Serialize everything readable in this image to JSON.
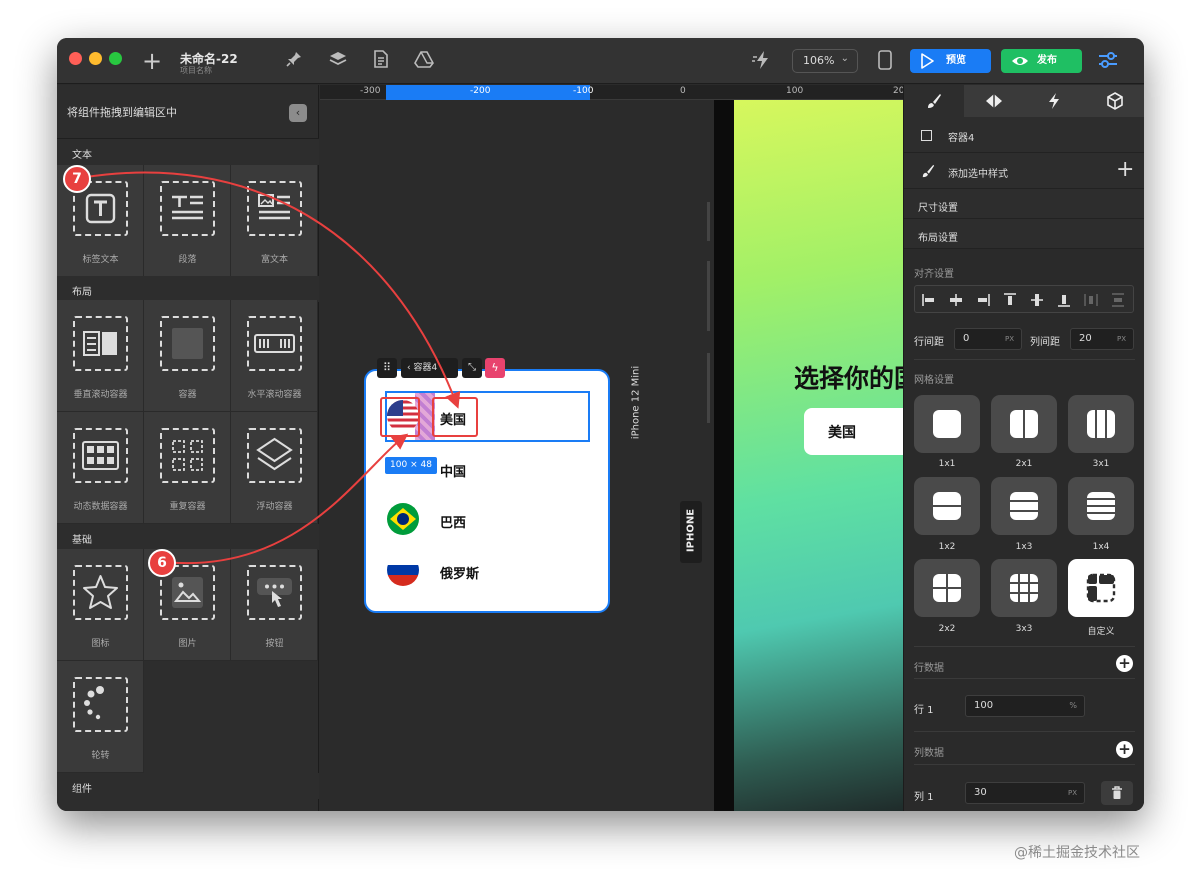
{
  "window": {
    "title": "未命名-22",
    "subtitle": "项目名称",
    "zoom": "106%",
    "preview_label": "预览",
    "publish_label": "发布"
  },
  "left_panel": {
    "header": "将组件拖拽到编辑区中",
    "sections": {
      "text": "文本",
      "layout": "布局",
      "basic": "基础",
      "components": "组件"
    },
    "text_items": [
      "标签文本",
      "段落",
      "富文本"
    ],
    "layout_items": [
      "垂直滚动容器",
      "容器",
      "水平滚动容器",
      "动态数据容器",
      "重复容器",
      "浮动容器"
    ],
    "basic_items": [
      "图标",
      "图片",
      "按钮",
      "轮转"
    ]
  },
  "canvas": {
    "ruler_labels": [
      "-300",
      "-200",
      "-100",
      "0",
      "100",
      "20"
    ],
    "toolbar_container": "容器4",
    "size_badge": "100 × 48",
    "countries": [
      "美国",
      "中国",
      "巴西",
      "俄罗斯"
    ],
    "device_name": "iPhone 12 Mini",
    "device_type": "IPHONE",
    "preview_title": "选择你的国家",
    "preview_selected": "美国",
    "steps": [
      "7",
      "6"
    ]
  },
  "right_panel": {
    "element_name": "容器4",
    "add_style": "添加选中样式",
    "size_settings": "尺寸设置",
    "layout_settings": "布局设置",
    "align_settings": "对齐设置",
    "row_gap_label": "行间距",
    "row_gap_value": "0",
    "col_gap_label": "列间距",
    "col_gap_value": "20",
    "unit_px": "PX",
    "grid_settings": "网格设置",
    "grid_options": [
      "1x1",
      "2x1",
      "3x1",
      "1x2",
      "1x3",
      "1x4",
      "2x2",
      "3x3",
      "自定义"
    ],
    "row_data": "行数据",
    "row1_label": "行 1",
    "row1_value": "100",
    "unit_pct": "%",
    "col_data": "列数据",
    "col1_label": "列 1",
    "col1_value": "30"
  },
  "watermark": "@稀土掘金技术社区",
  "colors": {
    "accent_blue": "#1a7cf5",
    "publish_green": "#1fbf63",
    "marker_red": "#e8403f",
    "bolt_pink": "#e8436e"
  }
}
